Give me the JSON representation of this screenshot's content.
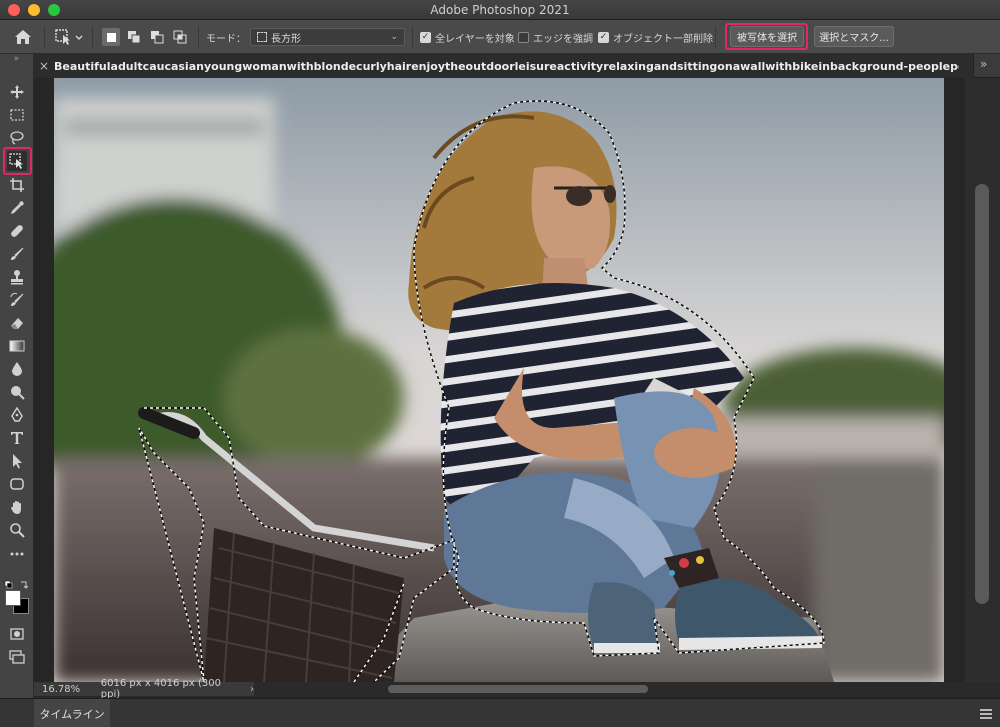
{
  "window": {
    "title": "Adobe Photoshop 2021",
    "colors": {
      "close": "#fe5f57",
      "minimize": "#febc2e",
      "zoom": "#28c840",
      "highlight": "#e0276a"
    }
  },
  "options_bar": {
    "mode_label": "モード：",
    "mode_value": "長方形",
    "sample_all_layers": {
      "label": "全レイヤーを対象",
      "checked": true
    },
    "enhance_edge": {
      "label": "エッジを強調",
      "checked": false
    },
    "object_subtract": {
      "label": "オブジェクト一部削除",
      "checked": true
    },
    "select_subject_label": "被写体を選択",
    "select_and_mask_label": "選択とマスク..."
  },
  "document": {
    "tab_name": "Beautifuladultcaucasianyoungwomanwithblondecurlyhairenjoytheoutdoorleisureactivityrelaxingandsittingonawallwithbikeinbackground-peopleportraitwithskyinbackground",
    "zoom": "16.78%",
    "dimensions": "6016 px x 4016 px (300 ppi)"
  },
  "tools": [
    "move-icon",
    "marquee-icon",
    "lasso-icon",
    "object-selection-icon",
    "crop-icon",
    "eyedropper-icon",
    "healing-icon",
    "brush-icon",
    "stamp-icon",
    "history-brush-icon",
    "eraser-icon",
    "gradient-icon",
    "blur-icon",
    "dodge-icon",
    "pen-icon",
    "type-icon",
    "path-selection-icon",
    "shape-icon",
    "hand-icon",
    "zoom-icon",
    "more-icon"
  ],
  "timeline": {
    "label": "タイムライン"
  }
}
